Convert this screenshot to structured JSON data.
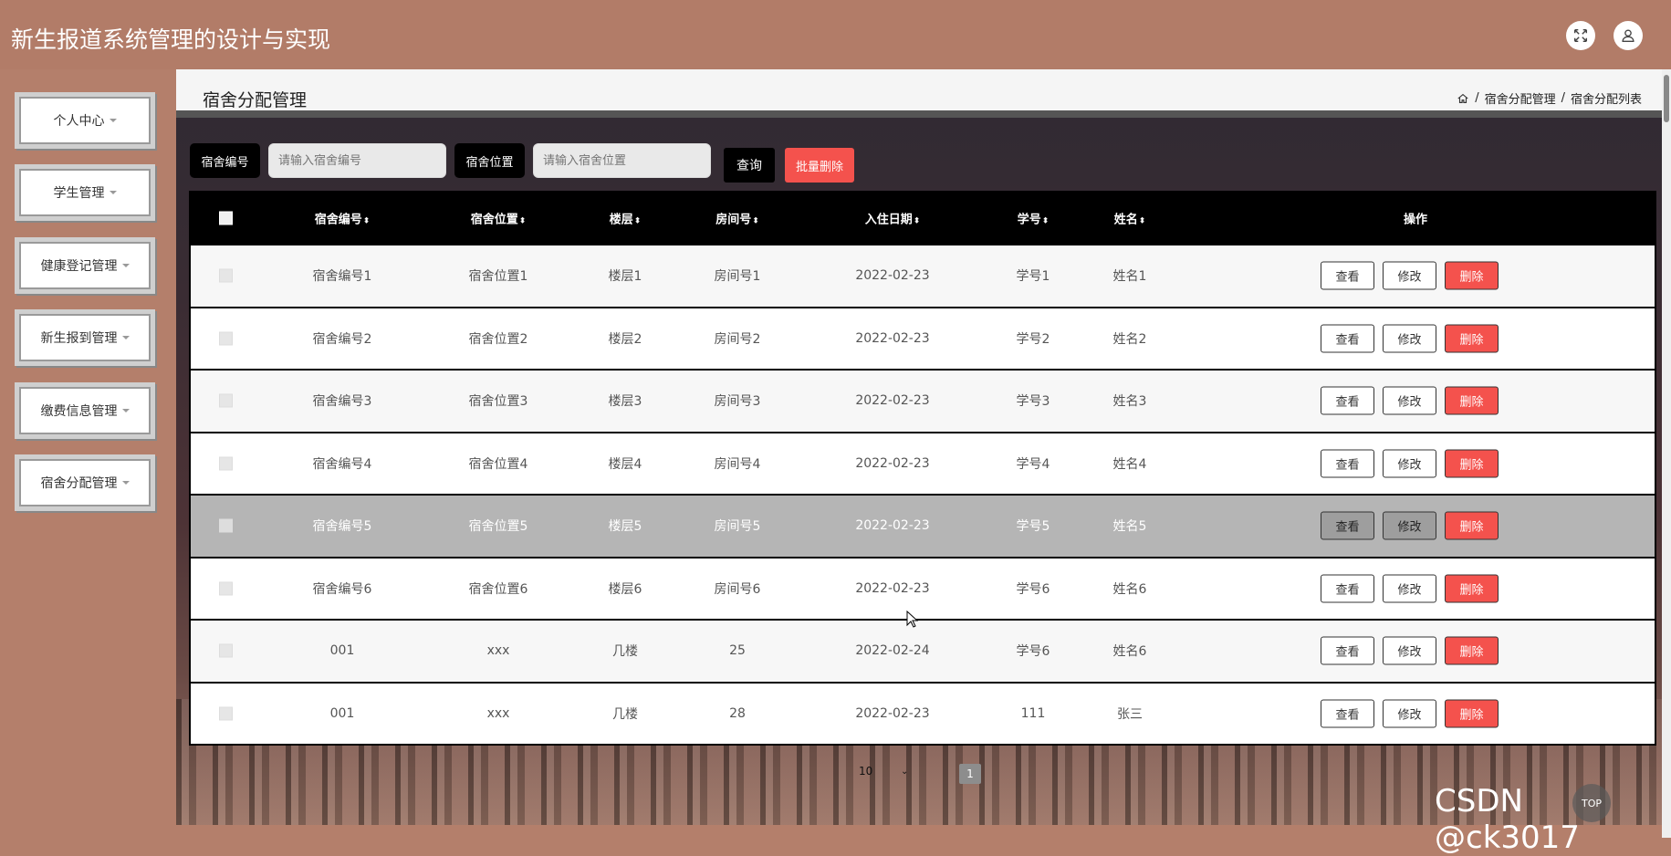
{
  "header": {
    "app_title": "新生报道系统管理的设计与实现",
    "icons": [
      "fullscreen-icon",
      "user-icon"
    ]
  },
  "sidebar": {
    "items": [
      {
        "label": "个人中心"
      },
      {
        "label": "学生管理"
      },
      {
        "label": "健康登记管理"
      },
      {
        "label": "新生报到管理"
      },
      {
        "label": "缴费信息管理"
      },
      {
        "label": "宿舍分配管理"
      }
    ]
  },
  "page": {
    "title": "宿舍分配管理",
    "breadcrumb": [
      "宿舍分配管理",
      "宿舍分配列表"
    ],
    "breadcrumb_sep": "/"
  },
  "search": {
    "field1_label": "宿舍编号",
    "field1_placeholder": "请输入宿舍编号",
    "field2_label": "宿舍位置",
    "field2_placeholder": "请输入宿舍位置",
    "query_label": "查询",
    "batch_delete_label": "批量删除"
  },
  "table": {
    "columns": [
      "宿舍编号",
      "宿舍位置",
      "楼层",
      "房间号",
      "入住日期",
      "学号",
      "姓名",
      "操作"
    ],
    "sort_glyph": "⬍",
    "rows": [
      [
        "宿舍编号1",
        "宿舍位置1",
        "楼层1",
        "房间号1",
        "2022-02-23",
        "学号1",
        "姓名1"
      ],
      [
        "宿舍编号2",
        "宿舍位置2",
        "楼层2",
        "房间号2",
        "2022-02-23",
        "学号2",
        "姓名2"
      ],
      [
        "宿舍编号3",
        "宿舍位置3",
        "楼层3",
        "房间号3",
        "2022-02-23",
        "学号3",
        "姓名3"
      ],
      [
        "宿舍编号4",
        "宿舍位置4",
        "楼层4",
        "房间号4",
        "2022-02-23",
        "学号4",
        "姓名4"
      ],
      [
        "宿舍编号5",
        "宿舍位置5",
        "楼层5",
        "房间号5",
        "2022-02-23",
        "学号5",
        "姓名5"
      ],
      [
        "宿舍编号6",
        "宿舍位置6",
        "楼层6",
        "房间号6",
        "2022-02-23",
        "学号6",
        "姓名6"
      ],
      [
        "001",
        "xxx",
        "几楼",
        "25",
        "2022-02-24",
        "学号6",
        "姓名6"
      ],
      [
        "001",
        "xxx",
        "几楼",
        "28",
        "2022-02-23",
        "111",
        "张三"
      ]
    ],
    "actions": {
      "view": "查看",
      "edit": "修改",
      "delete": "删除"
    },
    "hovered_row": 4
  },
  "pagination": {
    "page_size": "10",
    "current_page": "1"
  },
  "back_to_top": "TOP",
  "watermark": "CSDN @ck3017",
  "colors": {
    "header_bg": "#b27c68",
    "danger": "#f4524d",
    "table_head": "#000000"
  }
}
